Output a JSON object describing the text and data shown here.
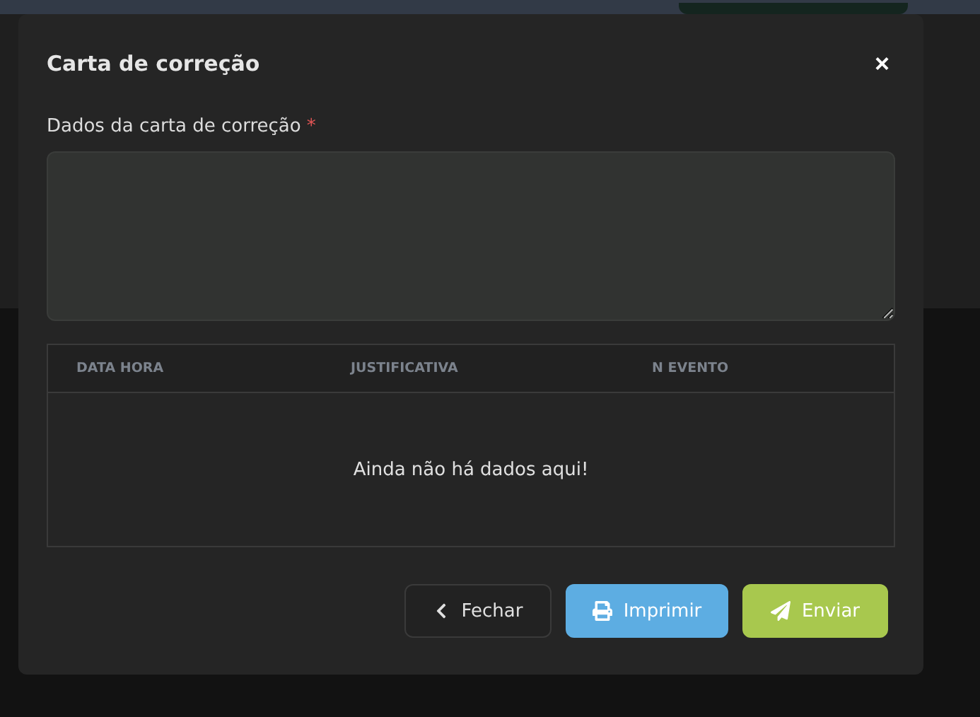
{
  "dialog": {
    "title": "Carta de correção",
    "close_label": "×"
  },
  "field": {
    "label": "Dados da carta de correção",
    "required_mark": "*"
  },
  "table": {
    "columns": [
      "DATA HORA",
      "JUSTIFICATIVA",
      "N EVENTO"
    ],
    "empty_message": "Ainda não há dados aqui!"
  },
  "buttons": [
    {
      "kind": "back",
      "label": "Fechar"
    },
    {
      "kind": "print",
      "label": "Imprimir"
    },
    {
      "kind": "send",
      "label": "Enviar"
    }
  ]
}
